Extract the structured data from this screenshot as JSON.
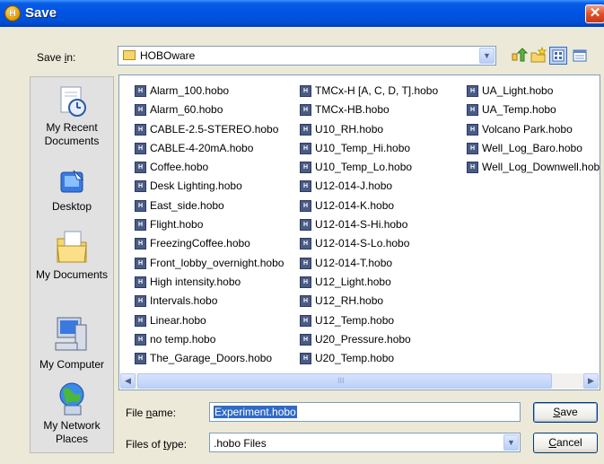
{
  "window": {
    "title": "Save",
    "close": "✕"
  },
  "save_in": {
    "label_pre": "Save ",
    "label_acc": "i",
    "label_post": "n:",
    "value": "HOBOware"
  },
  "places": [
    {
      "id": "recent",
      "label": "My Recent Documents"
    },
    {
      "id": "desktop",
      "label": "Desktop"
    },
    {
      "id": "docs",
      "label": "My Documents"
    },
    {
      "id": "computer",
      "label": "My Computer"
    },
    {
      "id": "network",
      "label": "My Network Places"
    }
  ],
  "file_icon_text": "H",
  "files": {
    "col1": [
      "Alarm_100.hobo",
      "Alarm_60.hobo",
      "CABLE-2.5-STEREO.hobo",
      "CABLE-4-20mA.hobo",
      "Coffee.hobo",
      "Desk Lighting.hobo",
      "East_side.hobo",
      "Flight.hobo",
      "FreezingCoffee.hobo",
      "Front_lobby_overnight.hobo",
      "High intensity.hobo",
      "Intervals.hobo",
      "Linear.hobo",
      "no temp.hobo",
      "The_Garage_Doors.hobo"
    ],
    "col2": [
      "TMCx-H [A, C, D, T].hobo",
      "TMCx-HB.hobo",
      "U10_RH.hobo",
      "U10_Temp_Hi.hobo",
      "U10_Temp_Lo.hobo",
      "U12-014-J.hobo",
      "U12-014-K.hobo",
      "U12-014-S-Hi.hobo",
      "U12-014-S-Lo.hobo",
      "U12-014-T.hobo",
      "U12_Light.hobo",
      "U12_RH.hobo",
      "U12_Temp.hobo",
      "U20_Pressure.hobo",
      "U20_Temp.hobo"
    ],
    "col3": [
      "UA_Light.hobo",
      "UA_Temp.hobo",
      "Volcano Park.hobo",
      "Well_Log_Baro.hobo",
      "Well_Log_Downwell.hobo"
    ]
  },
  "scrollbar": {
    "thumb_grip": "III"
  },
  "file_name": {
    "label_pre": "File ",
    "label_acc": "n",
    "label_post": "ame:",
    "value": "Experiment.hobo"
  },
  "file_type": {
    "label_pre": "Files of ",
    "label_acc": "t",
    "label_post": "ype:",
    "value": ".hobo Files"
  },
  "buttons": {
    "save": {
      "acc": "S",
      "rest": "ave"
    },
    "cancel": {
      "acc": "C",
      "rest": "ancel"
    }
  },
  "colors": {
    "title_bar": "#0054e3",
    "selection": "#316ac5",
    "dialog_bg": "#ece9d8"
  }
}
